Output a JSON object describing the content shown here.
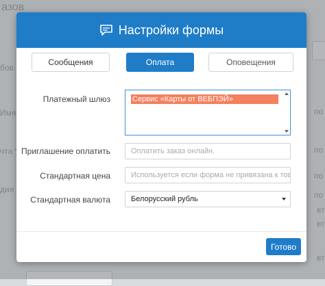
{
  "background": {
    "fragments": [
      "азов",
      "Имя *",
      "чта *",
      "дия *",
      "бов",
      "по",
      "по",
      "по",
      "по",
      "вт",
      "вт",
      "вт"
    ]
  },
  "modal": {
    "title": "Настройки формы",
    "tabs": [
      {
        "label": "Сообщения",
        "active": false
      },
      {
        "label": "Оплата",
        "active": true
      },
      {
        "label": "Оповещения",
        "active": false
      }
    ],
    "fields": {
      "gateway": {
        "label": "Платежный шлюз",
        "options": [
          "Сервис «Карты от ВЕБПЭЙ»"
        ],
        "selected": "Сервис «Карты от ВЕБПЭЙ»"
      },
      "invite": {
        "label": "Приглашение оплатить",
        "placeholder": "Оплатить заказ онлайн."
      },
      "price": {
        "label": "Стандартная цена",
        "placeholder": "Используется если форма не привязана к товару"
      },
      "currency": {
        "label": "Стандартная валюта",
        "value": "Белорусский рубль"
      }
    },
    "done_label": "Готово"
  },
  "colors": {
    "accent": "#1f7dc8",
    "selection": "#f4805e"
  }
}
